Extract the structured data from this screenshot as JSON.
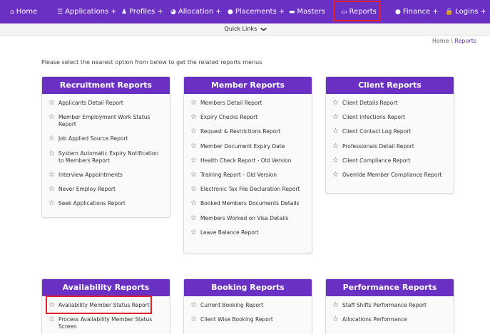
{
  "topnav": {
    "items": [
      {
        "label": "Home",
        "icon": "home-icon",
        "glyph": "⌂",
        "plus": ""
      },
      {
        "label": "Applications",
        "icon": "list-icon",
        "glyph": "☰",
        "plus": "+"
      },
      {
        "label": "Profiles",
        "icon": "user-icon",
        "glyph": "♟",
        "plus": "+"
      },
      {
        "label": "Allocation",
        "icon": "pie-icon",
        "glyph": "◕",
        "plus": "+"
      },
      {
        "label": "Placements",
        "icon": "globe-icon",
        "glyph": "●",
        "plus": "+"
      },
      {
        "label": "Masters",
        "icon": "folder-icon",
        "glyph": "▬",
        "plus": ""
      },
      {
        "label": "Reports",
        "icon": "folder-open-icon",
        "glyph": "▭",
        "plus": ""
      },
      {
        "label": "Finance",
        "icon": "globe-icon",
        "glyph": "●",
        "plus": "+"
      },
      {
        "label": "Logins",
        "icon": "lock-icon",
        "glyph": "🔒",
        "plus": "+"
      }
    ],
    "active": "Reports",
    "accent_color": "#6a2fc3",
    "highlight_color": "#e0212a"
  },
  "quicklinks": {
    "label": "Quick Links",
    "icon": "chevron-down-icon",
    "glyph": "❯"
  },
  "breadcrumb": {
    "home": "Home",
    "separator": "\\",
    "current": "Reports"
  },
  "intro": "Please select the nearest option from below to get the related reports menus",
  "cards": {
    "recruitment": {
      "title": "Recruitment Reports",
      "items": [
        "Applicants Detail Report",
        "Member Employment Work Status Report",
        "Job Applied Source Report",
        "System Automatic Expiry Notification to Members Report",
        "Interview Appointments",
        "Never Employ Report",
        "Seek Applications Report"
      ]
    },
    "member": {
      "title": "Member Reports",
      "items": [
        "Members Detail Report",
        "Expiry Checks Report",
        "Request & Restrictions Report",
        "Member Document Expiry Date",
        "Health Check Report - Old Version",
        "Training Report - Old Version",
        "Electronic Tax File Declaration Report",
        "Booked Members Documents Details",
        "Members Worked on Visa Details",
        "Leave Balance Report"
      ]
    },
    "client": {
      "title": "Client Reports",
      "items": [
        "Client Details Report",
        "Client Infections Report",
        "Client Contact Log Report",
        "Professionals Detail Report",
        "Client Compliance Report",
        "Override Member Compliance Report"
      ]
    },
    "availability": {
      "title": "Availability Reports",
      "items": [
        "Availability Member Status Report",
        "Process Availability Member Status Screen"
      ]
    },
    "booking": {
      "title": "Booking Reports",
      "items": [
        "Current Booking Report",
        "Client Wise Booking Report"
      ]
    },
    "performance": {
      "title": "Performance Reports",
      "items": [
        "Staff Shifts Performance Report",
        "Allocations Performance"
      ]
    }
  },
  "star_icon": "star-icon",
  "star_glyph": "☆"
}
